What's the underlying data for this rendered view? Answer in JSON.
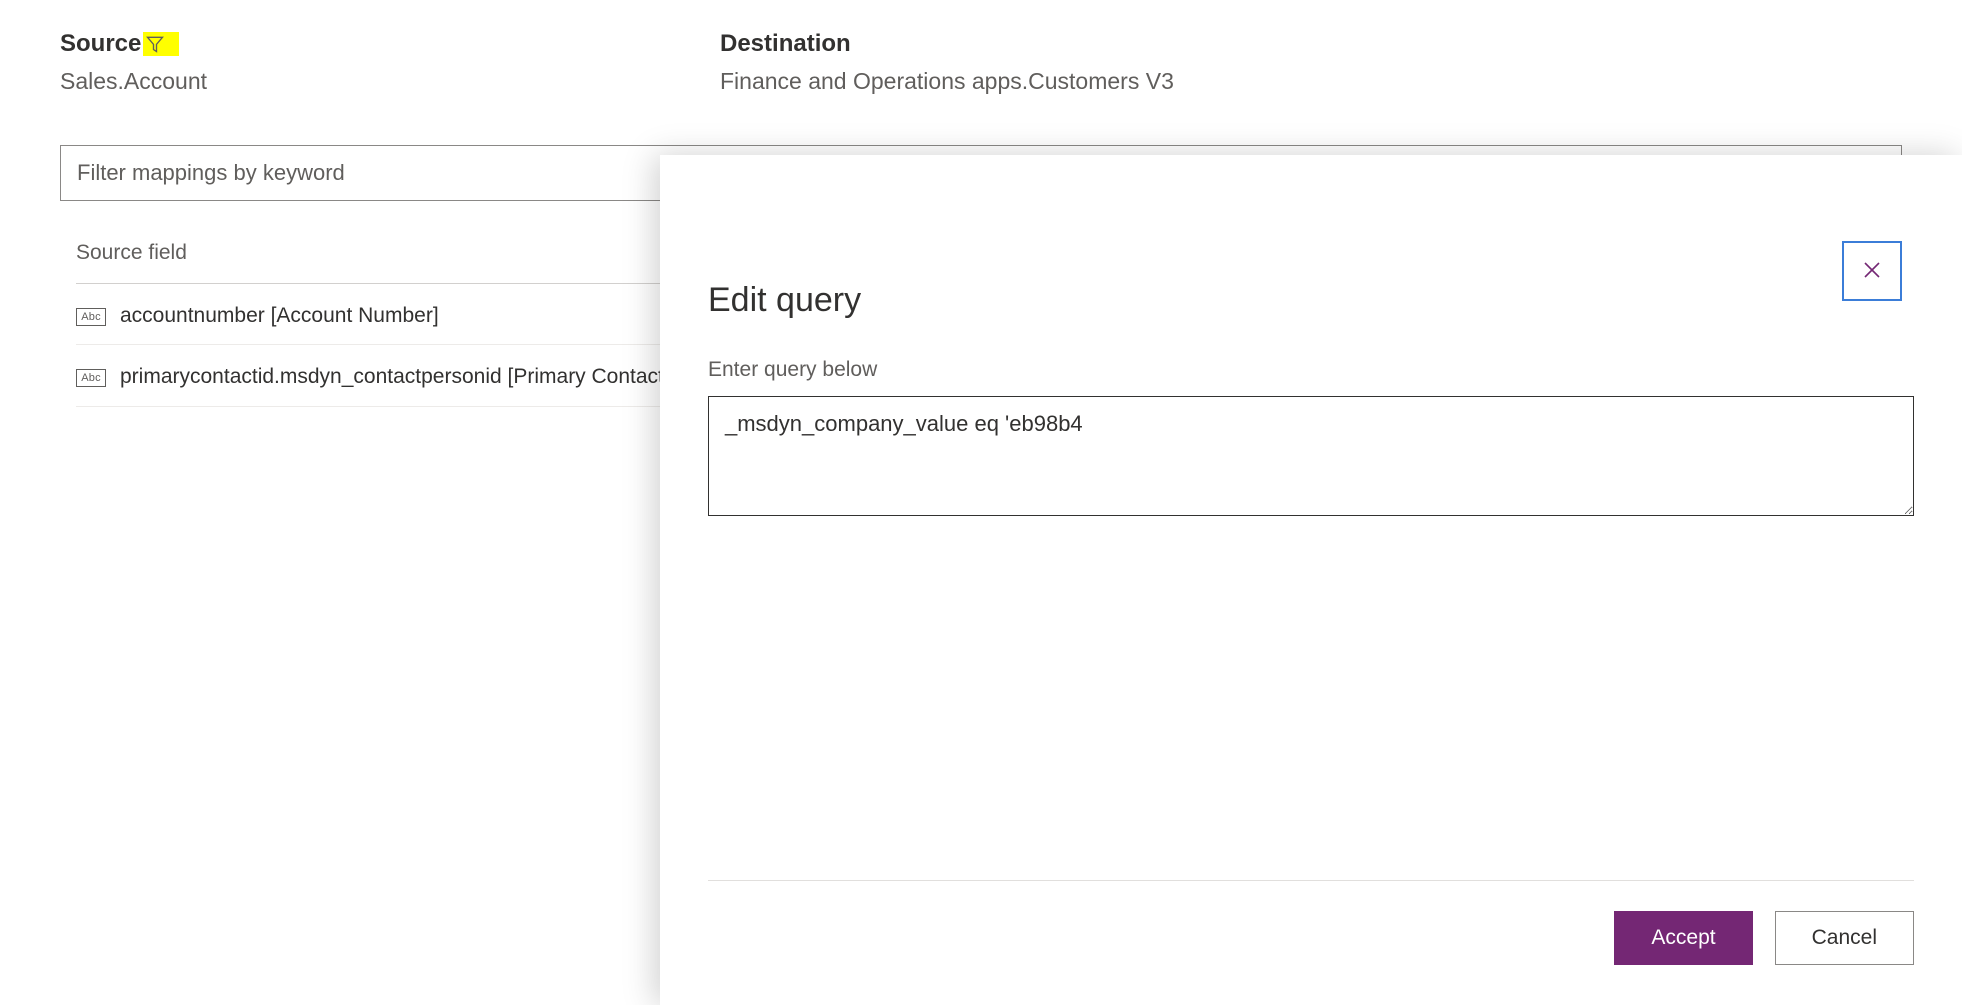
{
  "source": {
    "label": "Source",
    "value": "Sales.Account"
  },
  "destination": {
    "label": "Destination",
    "value": "Finance and Operations apps.Customers V3"
  },
  "filter": {
    "placeholder": "Filter mappings by keyword"
  },
  "table": {
    "source_field_header": "Source field",
    "rows": [
      {
        "badge": "Abc",
        "text": "accountnumber [Account Number]"
      },
      {
        "badge": "Abc",
        "text": "primarycontactid.msdyn_contactpersonid [Primary Contact (Account Number/Contact Person ID)]"
      }
    ]
  },
  "dialog": {
    "title": "Edit query",
    "label": "Enter query below",
    "query_value": "_msdyn_company_value eq 'eb98b4",
    "accept": "Accept",
    "cancel": "Cancel"
  }
}
